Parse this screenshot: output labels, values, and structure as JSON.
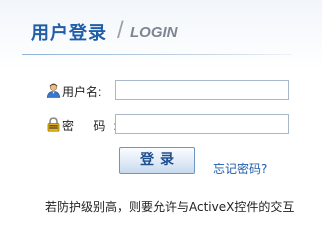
{
  "header": {
    "title_cn": "用户登录",
    "slash": "/",
    "title_en": "LOGIN"
  },
  "form": {
    "username": {
      "label": "用户名:",
      "value": "",
      "placeholder": "",
      "icon": "user-icon"
    },
    "password": {
      "label": "密 码:",
      "value": "",
      "placeholder": "",
      "icon": "lock-icon"
    },
    "login_button": "登录",
    "forgot_link": "忘记密码?"
  },
  "notice": "若防护级别高，则要允许与ActiveX控件的交互",
  "colors": {
    "title": "#215ea8",
    "link": "#1e5cae",
    "button_border": "#6e96c3"
  }
}
